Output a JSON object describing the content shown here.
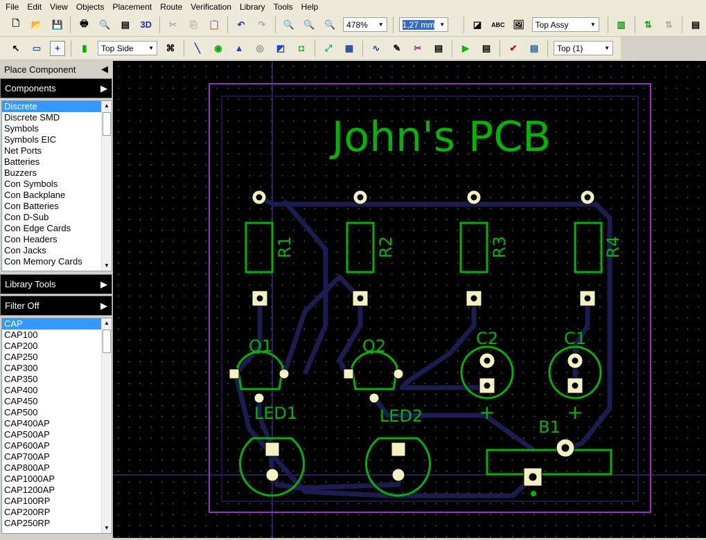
{
  "menu": [
    "File",
    "Edit",
    "View",
    "Objects",
    "Placement",
    "Route",
    "Verification",
    "Library",
    "Tools",
    "Help"
  ],
  "toolbar": {
    "zoom": "478%",
    "grid": "1,27 mm",
    "view_mode": "Top Assy",
    "side": "Top Side",
    "layer": "Top (1)",
    "three_d": "3D",
    "abc": "ABC"
  },
  "panel": {
    "place_component": "Place Component",
    "components": "Components",
    "library_tools": "Library Tools",
    "filter": "Filter Off",
    "categories": [
      "Discrete",
      "Discrete SMD",
      "Symbols",
      "Symbols EIC",
      "Net Ports",
      "Batteries",
      "Buzzers",
      "Con Symbols",
      "Con Backplane",
      "Con Batteries",
      "Con D-Sub",
      "Con Edge Cards",
      "Con Headers",
      "Con Jacks",
      "Con Memory Cards"
    ],
    "parts": [
      "CAP",
      "CAP100",
      "CAP200",
      "CAP250",
      "CAP300",
      "CAP350",
      "CAP400",
      "CAP450",
      "CAP500",
      "CAP400AP",
      "CAP500AP",
      "CAP600AP",
      "CAP700AP",
      "CAP800AP",
      "CAP1000AP",
      "CAP1200AP",
      "CAP100RP",
      "CAP200RP",
      "CAP250RP"
    ]
  },
  "pcb": {
    "title": "John's PCB",
    "labels": {
      "r1": "R1",
      "r2": "R2",
      "r3": "R3",
      "r4": "R4",
      "q1": "Q1",
      "q2": "Q2",
      "c1": "C1",
      "c2": "C2",
      "led1": "LED1",
      "led2": "LED2",
      "b1": "B1",
      "plus": "+"
    },
    "colors": {
      "silk": "#00b400",
      "outline": "#9b30c8",
      "trace": "#181848",
      "pad": "#f5f0c0"
    }
  }
}
